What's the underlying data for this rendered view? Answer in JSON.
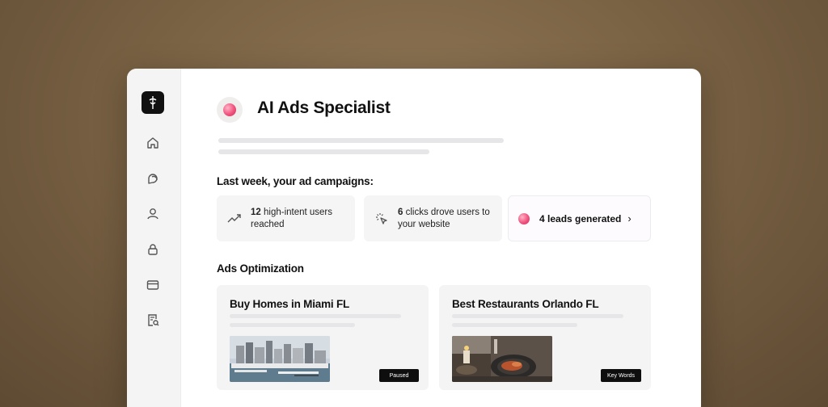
{
  "sidebar": {
    "icons": [
      "logo-icon",
      "home-icon",
      "chat-icon",
      "user-icon",
      "lock-icon",
      "card-icon",
      "report-search-icon"
    ]
  },
  "header": {
    "title": "AI Ads Specialist"
  },
  "summary": {
    "heading": "Last week, your ad campaigns:",
    "stats": [
      {
        "value": "12",
        "text": " high-intent users reached",
        "icon": "trending-up-icon"
      },
      {
        "value": "6",
        "text": " clicks drove users to your website",
        "icon": "cursor-click-icon"
      }
    ],
    "leads": {
      "label": "4 leads generated",
      "icon": "orb-icon"
    }
  },
  "optimization": {
    "heading": "Ads Optimization",
    "cards": [
      {
        "title": "Buy Homes in Miami FL",
        "badge": "Paused",
        "image": "miami-skyline-marina"
      },
      {
        "title": "Best Restaurants Orlando FL",
        "badge": "Key Words",
        "image": "restaurant-plate"
      }
    ]
  },
  "colors": {
    "accent": "#f0527d",
    "dark": "#111111",
    "panel": "#f4f4f5"
  }
}
